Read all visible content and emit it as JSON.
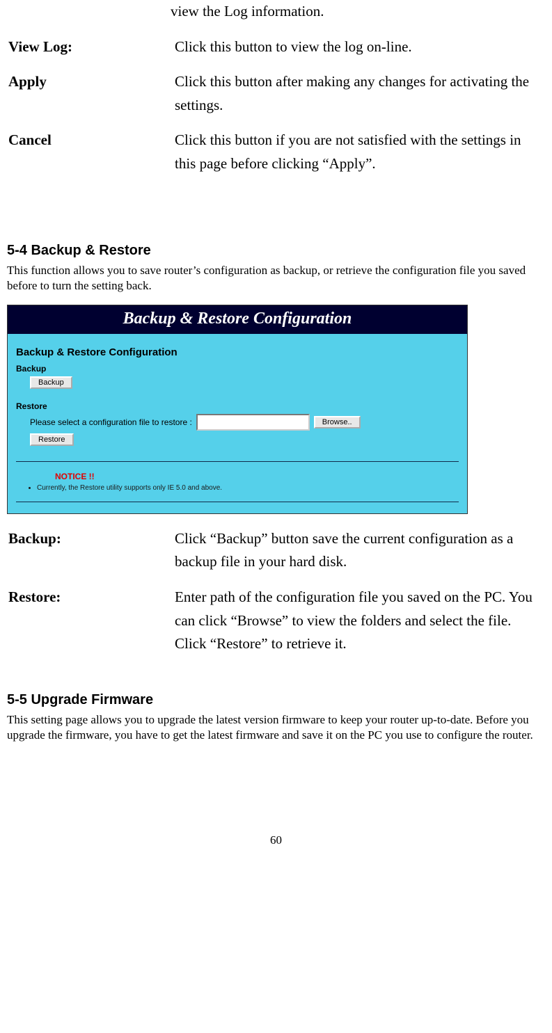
{
  "top_desc": "view the Log information.",
  "defs1": {
    "view_log_label": "View Log:",
    "view_log_desc": "Click this button to view the log on-line.",
    "apply_label": "Apply",
    "apply_desc": "Click this button after making any changes for activating the settings.",
    "cancel_label": "Cancel",
    "cancel_desc": "Click this button if you are not satisfied with the settings in this page before clicking “Apply”."
  },
  "section_backup": {
    "heading": "5-4 Backup & Restore",
    "intro": "This function allows you to save router’s configuration as backup, or retrieve the configuration file you saved before to turn the setting back."
  },
  "screenshot": {
    "title": "Backup & Restore Configuration",
    "sub_heading": "Backup & Restore Configuration",
    "backup_label": "Backup",
    "backup_button": "Backup",
    "restore_label": "Restore",
    "restore_prompt": "Please select a configuration file to restore :",
    "browse_button": "Browse..",
    "restore_button": "Restore",
    "notice_label": "NOTICE !!",
    "notice_text": "Currently, the Restore utility supports only IE 5.0 and above."
  },
  "defs2": {
    "backup_label": "Backup:",
    "backup_desc": "Click “Backup” button save the current configuration as a backup file in your hard disk.",
    "restore_label": "Restore:",
    "restore_desc": "Enter path of the configuration file you saved on the PC. You can click “Browse” to view the folders and select the file. Click “Restore” to retrieve it."
  },
  "section_upgrade": {
    "heading": "5-5 Upgrade Firmware",
    "intro": "This setting page allows you to upgrade the latest version firmware to keep your router up-to-date. Before you upgrade the firmware, you have to get the latest firmware and save it on the PC you use to configure the router."
  },
  "page_number": "60"
}
